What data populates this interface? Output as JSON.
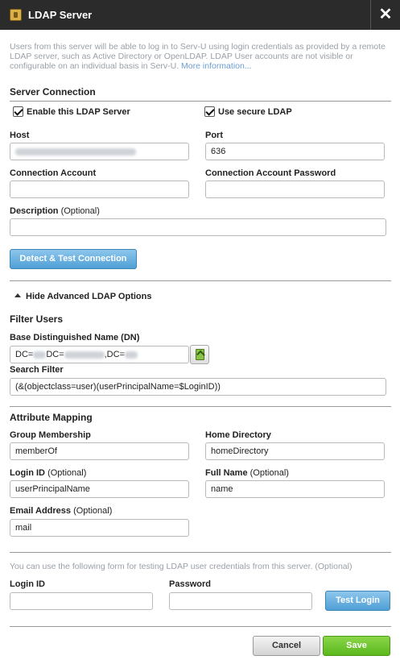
{
  "window": {
    "title": "LDAP Server",
    "close_label": "✕"
  },
  "intro": {
    "text": "Users from this server will be able to log in to Serv-U using login credentials as provided by a remote LDAP server, such as Active Directory or OpenLDAP. LDAP User accounts are not visible or configurable on an individual basis in Serv-U.",
    "link": "More information..."
  },
  "server_connection": {
    "title": "Server Connection",
    "enable_label": "Enable this LDAP Server",
    "secure_label": "Use secure LDAP",
    "host_label": "Host",
    "port_label": "Port",
    "port_value": "636",
    "account_label": "Connection Account",
    "password_label": "Connection Account Password",
    "description_label": "Description",
    "optional": "(Optional)",
    "detect_button": "Detect & Test Connection"
  },
  "advanced": {
    "toggle_label": "Hide Advanced LDAP Options"
  },
  "filter_users": {
    "title": "Filter Users",
    "dn_label": "Base Distinguished Name (DN)",
    "dn_part1": "DC=",
    "dn_part2": "DC=",
    "dn_part3": ",DC=",
    "search_label": "Search Filter",
    "search_value": "(&(objectclass=user)(userPrincipalName=$LoginID))"
  },
  "attribute_mapping": {
    "title": "Attribute Mapping",
    "group_label": "Group Membership",
    "group_value": "memberOf",
    "home_label": "Home Directory",
    "home_value": "homeDirectory",
    "login_label": "Login ID",
    "login_value": "userPrincipalName",
    "fullname_label": "Full Name",
    "fullname_value": "name",
    "email_label": "Email Address",
    "email_value": "mail",
    "optional": "(Optional)"
  },
  "test": {
    "note": "You can use the following form for testing LDAP user credentials from this server. (Optional)",
    "login_label": "Login ID",
    "password_label": "Password",
    "test_button": "Test Login"
  },
  "footer": {
    "cancel": "Cancel",
    "save": "Save"
  }
}
